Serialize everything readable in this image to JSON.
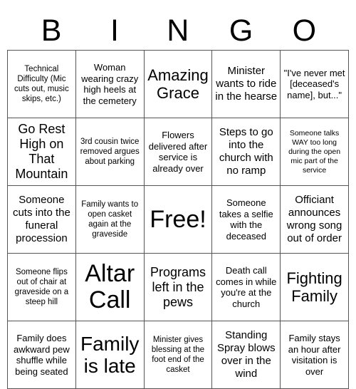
{
  "card": {
    "header_letters": [
      "B",
      "I",
      "N",
      "G",
      "O"
    ],
    "free_space_label": "Free!",
    "rows": [
      [
        {
          "text": "Technical Difficulty (Mic cuts out, music skips, etc.)",
          "size": "fs-s"
        },
        {
          "text": "Woman wearing crazy high heels at the cemetery",
          "size": "fs-m"
        },
        {
          "text": "Amazing Grace",
          "size": "fs-2xl"
        },
        {
          "text": "Minister wants to ride in the hearse",
          "size": "fs-l"
        },
        {
          "text": "\"I've never met [deceased's name], but...\"",
          "size": "fs-m"
        }
      ],
      [
        {
          "text": "Go Rest High on That Mountain",
          "size": "fs-xl"
        },
        {
          "text": "3rd cousin twice removed argues about parking",
          "size": "fs-s"
        },
        {
          "text": "Flowers delivered after service is already over",
          "size": "fs-m"
        },
        {
          "text": "Steps to go into the church with no ramp",
          "size": "fs-l"
        },
        {
          "text": "Someone talks WAY too long during the open mic part of the service",
          "size": "fs-xs"
        }
      ],
      [
        {
          "text": "Someone cuts into the funeral procession",
          "size": "fs-l"
        },
        {
          "text": "Family wants to open casket again at the graveside",
          "size": "fs-s"
        },
        {
          "text": "Free!",
          "size": "fs-4xl"
        },
        {
          "text": "Someone takes a selfie with the deceased",
          "size": "fs-m"
        },
        {
          "text": "Officiant announces wrong song out of order",
          "size": "fs-l"
        }
      ],
      [
        {
          "text": "Someone flips out of chair at graveside on a steep hill",
          "size": "fs-s"
        },
        {
          "text": "Altar Call",
          "size": "fs-4xl"
        },
        {
          "text": "Programs left in the pews",
          "size": "fs-xl"
        },
        {
          "text": "Death call comes in while you're at the church",
          "size": "fs-m"
        },
        {
          "text": "Fighting Family",
          "size": "fs-2xl"
        }
      ],
      [
        {
          "text": "Family does awkward pew shuffle while being seated",
          "size": "fs-m"
        },
        {
          "text": "Family is late",
          "size": "fs-3xl"
        },
        {
          "text": "Minister gives blessing at the foot end of the casket",
          "size": "fs-s"
        },
        {
          "text": "Standing Spray blows over in the wind",
          "size": "fs-l"
        },
        {
          "text": "Family stays an hour after visitation is over",
          "size": "fs-m"
        }
      ]
    ]
  },
  "colors": {
    "background": "#ffffff",
    "text": "#000000",
    "border": "#555555"
  }
}
